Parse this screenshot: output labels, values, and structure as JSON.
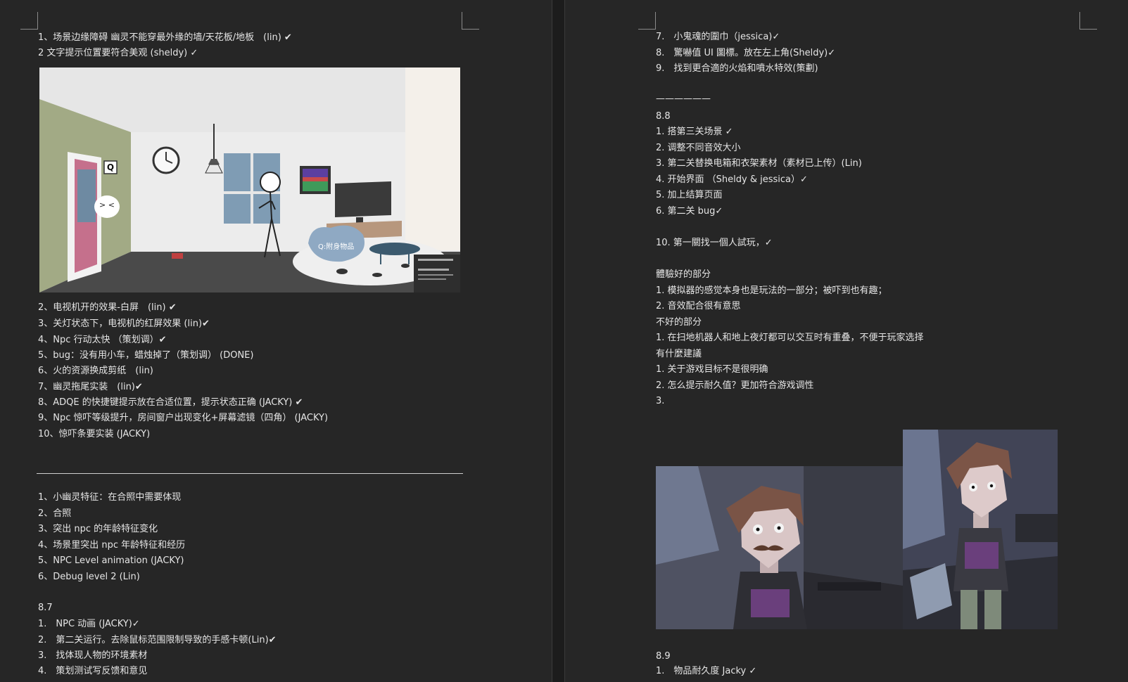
{
  "left": {
    "lines_a": [
      "1、场景边缘障碍 幽灵不能穿最外缘的墙/天花板/地板　(lin) ✔",
      "2 文字提示位置要符合美观 (sheldy) ✓"
    ],
    "scene": {
      "door_key": "Q",
      "ghost_face": "> <",
      "sofa_hint": "Q:附身物品"
    },
    "lines_b": [
      "2、电视机开的效果-白屏　(lin) ✔",
      "3、关灯状态下，电视机的红屏效果 (lin)✔",
      "4、Npc 行动太快 （策划调）✔",
      "5、bug：没有用小车，蜡烛掉了（策划调） (DONE)",
      "6、火的资源换成剪纸　(lin)",
      "7、幽灵拖尾实装　(lin)✔",
      "8、ADQE 的快捷键提示放在合适位置，提示状态正确 (JACKY) ✔",
      "9、Npc 惊吓等级提升，房间窗户出现变化+屏幕滤镜（四角） (JACKY)",
      "10、惊吓条要实装 (JACKY)"
    ],
    "lines_c": [
      "1、小幽灵特征：在合照中需要体现",
      "2、合照",
      "3、突出 npc 的年龄特征变化",
      "4、场景里突出 npc 年龄特征和经历",
      "5、NPC Level animation (JACKY)",
      "6、Debug level 2 (Lin)"
    ],
    "heading_87": "8.7",
    "lines_d": [
      "1.　NPC 动画 (JACKY)✓",
      "2.　第二关运行。去除鼠标范围限制导致的手感卡顿(Lin)✔",
      "3.　找体现人物的环境素材",
      "4.　策划测试写反馈和意见"
    ]
  },
  "right": {
    "lines_a": [
      "7.　小鬼魂的圍巾（jessica)✓",
      "8.　驚嚇值 UI 圖標。放在左上角(Sheldy)✓",
      "9.　找到更合適的火焰和噴水特效(策劃)"
    ],
    "dashes": "——————",
    "heading_88": "8.8",
    "lines_b": [
      "1. 搭第三关场景 ✓",
      "2. 调整不同音效大小",
      "3. 第二关替换电箱和衣架素材（素材已上传）(Lin)",
      "4. 开始界面 （Sheldy & jessica）✓",
      "5. 加上结算页面",
      "6. 第二关 bug✓"
    ],
    "line_10": "10. 第一關找一個人試玩，✓",
    "good_title": "體驗好的部分",
    "good_items": [
      "1. 模拟器的感觉本身也是玩法的一部分；被吓到也有趣；",
      "2. 音效配合很有意思"
    ],
    "bad_title": "不好的部分",
    "bad_items": [
      "1. 在扫地机器人和地上夜灯都可以交互时有重叠，不便于玩家选择"
    ],
    "suggest_title": "有什麼建議",
    "suggest_items": [
      "1. 关于游戏目标不是很明确",
      "2. 怎么提示耐久值？更加符合游戏调性",
      "3."
    ],
    "heading_89": "8.9",
    "line_89_1": "1.　物品耐久度 Jacky ✓"
  }
}
